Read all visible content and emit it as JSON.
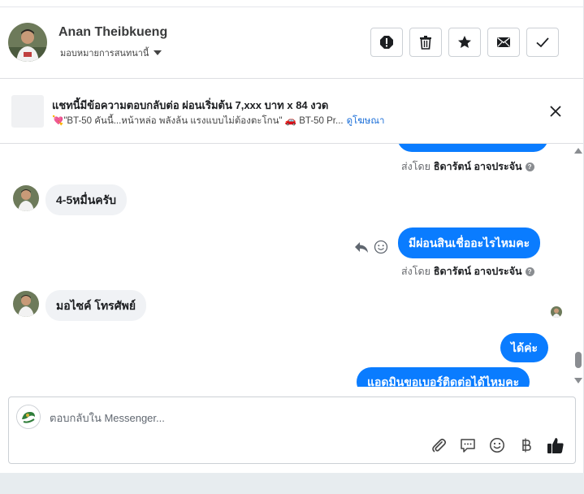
{
  "header": {
    "contact_name": "Anan Theibkueng",
    "assign_label": "มอบหมายการสนทนานี้",
    "actions": [
      "mark-spam",
      "delete",
      "star",
      "mark-unread",
      "mark-done"
    ]
  },
  "ad": {
    "title": "แชทนี้มีข้อความตอบกลับต่อ ผ่อนเริ่มต้น 7,xxx บาท x 84 งวด",
    "snippet": "💘\"BT-50 คันนี้...หน้าหล่อ พลังล้น แรงแบบไม่ต้องตะโกน\" 🚗 BT-50 Pr...",
    "link": "ดูโฆษณา"
  },
  "messages": {
    "sentby_prefix": "ส่งโดย",
    "sentby_name": "ธิดารัตน์ อาจประจัน",
    "incoming_1": "4-5หมื่นครับ",
    "outgoing_1": "มีผ่อนสินเชื่ออะไรไหมคะ",
    "incoming_2": "มอไซค์ โทรศัพย์",
    "outgoing_2": "ได้ค่ะ",
    "outgoing_3": "แอดมินขอเบอร์ติดต่อได้ไหมคะ"
  },
  "composer": {
    "placeholder": "ตอบกลับใน Messenger..."
  },
  "colors": {
    "brand_blue": "#0a7cff",
    "incoming_bg": "#f0f2f5",
    "link": "#1a6ed8"
  }
}
